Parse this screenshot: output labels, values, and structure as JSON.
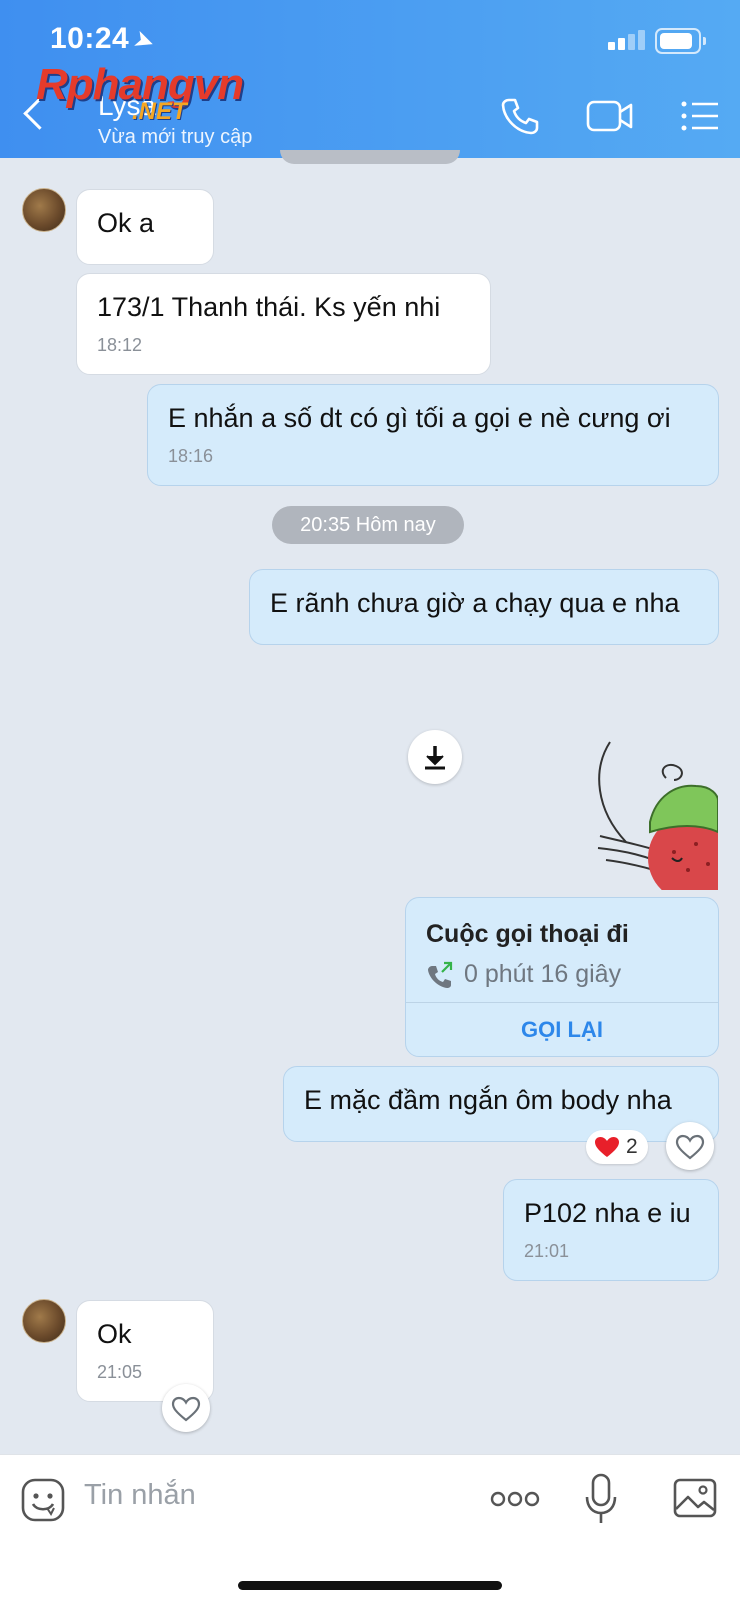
{
  "status_bar": {
    "time": "10:24"
  },
  "header": {
    "contact_name": "Lysa",
    "contact_status": "Vừa mới truy cập",
    "watermark_main": "Rphangvn",
    "watermark_sub": ".NET",
    "icons": [
      "back-icon",
      "phone-icon",
      "video-call-icon",
      "menu-list-icon"
    ]
  },
  "messages": [
    {
      "direction": "in",
      "text": "Ok a",
      "time": ""
    },
    {
      "direction": "in",
      "text": "173/1  Thanh thái. Ks yến nhi",
      "time": "18:12"
    },
    {
      "direction": "out",
      "text": "E nhắn a số dt có gì tối a gọi e nè cưng ơi",
      "time": "18:16"
    },
    {
      "direction": "out",
      "text": "E rãnh chưa giờ a chạy qua e nha",
      "time": ""
    },
    {
      "direction": "out",
      "text": "E mặc đầm ngắn ôm body nha",
      "time": ""
    },
    {
      "direction": "out",
      "text": "P102 nha e iu",
      "time": "21:01"
    },
    {
      "direction": "in",
      "text": "Ok",
      "time": "21:05"
    }
  ],
  "date_separator": "20:35 Hôm nay",
  "call_card": {
    "title": "Cuộc gọi thoại đi",
    "duration": "0 phút 16 giây",
    "action": "GỌI LẠI"
  },
  "reaction": {
    "emoji": "heart",
    "count": "2"
  },
  "composer": {
    "placeholder": "Tin nhắn"
  },
  "colors": {
    "header": "#4a9cf2",
    "out_bubble": "#d5ebfb",
    "accent": "#2d87ea"
  }
}
